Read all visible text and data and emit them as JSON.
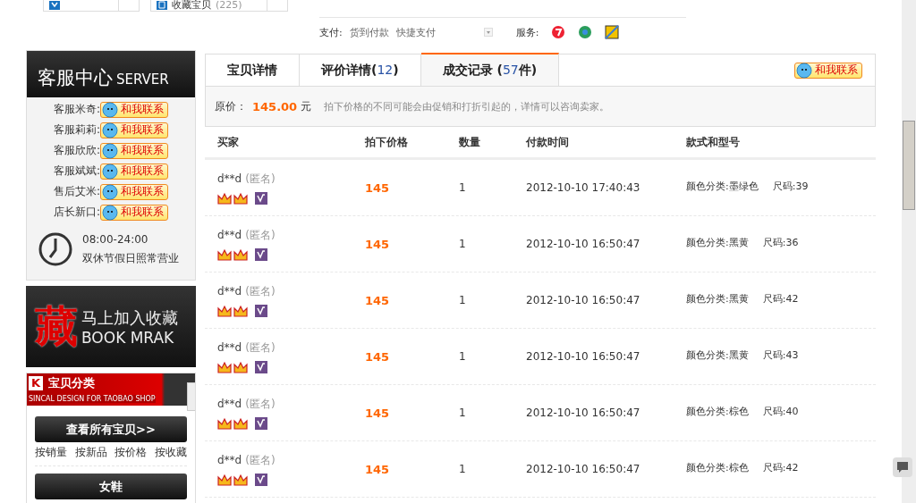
{
  "top_buttons": [
    {
      "kind": "check"
    },
    {
      "kind": "shirt",
      "label": "收藏宝贝",
      "count": "(225)"
    }
  ],
  "payment": {
    "label": "支付:",
    "options": [
      "货到付款",
      "快捷支付"
    ],
    "service_label": "服务:"
  },
  "service_center": {
    "title": "客服中心",
    "title_en": "SERVER",
    "agents": [
      {
        "name": "客服米奇:",
        "contact": "和我联系"
      },
      {
        "name": "客服莉莉:",
        "contact": "和我联系"
      },
      {
        "name": "客服欣欣:",
        "contact": "和我联系"
      },
      {
        "name": "客服斌斌:",
        "contact": "和我联系"
      },
      {
        "name": "售后艾米:",
        "contact": "和我联系"
      },
      {
        "name": "店长新口:",
        "contact": "和我联系"
      }
    ],
    "hours": "08:00-24:00",
    "note": "双休节假日照常营业"
  },
  "bookmark": {
    "glyph": "藏",
    "title": "马上加入收藏",
    "title_en": "BOOK MRAK"
  },
  "categories": {
    "logo": "K",
    "title": "宝贝分类",
    "subtitle": "SINCAL DESIGN FOR TAOBAO SHOP",
    "all_button": "查看所有宝贝>>",
    "sort_links": [
      "按销量",
      "按新品",
      "按价格",
      "按收藏"
    ],
    "items": [
      "女鞋"
    ]
  },
  "tabs": [
    {
      "label": "宝贝详情",
      "selected": false
    },
    {
      "label": "评价详情(",
      "count": "12",
      "suffix": ")",
      "selected": false
    },
    {
      "label": "成交记录 (",
      "count": "57",
      "suffix": "件)",
      "selected": true
    }
  ],
  "tab_contact": "和我联系",
  "price_info": {
    "label": "原价：",
    "price": "145.00",
    "unit": "元",
    "note": "拍下价格的不同可能会由促销和打折引起的，详情可以咨询卖家。"
  },
  "table": {
    "columns": [
      "买家",
      "拍下价格",
      "数量",
      "付款时间",
      "款式和型号"
    ],
    "rows": [
      {
        "buyer": "d**d",
        "anon": "(匿名)",
        "price": "145",
        "qty": "1",
        "time": "2012-10-10 17:40:43",
        "variant": "颜色分类:墨绿色",
        "size": "尺码:39"
      },
      {
        "buyer": "d**d",
        "anon": "(匿名)",
        "price": "145",
        "qty": "1",
        "time": "2012-10-10 16:50:47",
        "variant": "颜色分类:黑黄",
        "size": "尺码:36"
      },
      {
        "buyer": "d**d",
        "anon": "(匿名)",
        "price": "145",
        "qty": "1",
        "time": "2012-10-10 16:50:47",
        "variant": "颜色分类:黑黄",
        "size": "尺码:42"
      },
      {
        "buyer": "d**d",
        "anon": "(匿名)",
        "price": "145",
        "qty": "1",
        "time": "2012-10-10 16:50:47",
        "variant": "颜色分类:黑黄",
        "size": "尺码:43"
      },
      {
        "buyer": "d**d",
        "anon": "(匿名)",
        "price": "145",
        "qty": "1",
        "time": "2012-10-10 16:50:47",
        "variant": "颜色分类:棕色",
        "size": "尺码:40"
      },
      {
        "buyer": "d**d",
        "anon": "(匿名)",
        "price": "145",
        "qty": "1",
        "time": "2012-10-10 16:50:47",
        "variant": "颜色分类:棕色",
        "size": "尺码:42"
      }
    ]
  }
}
